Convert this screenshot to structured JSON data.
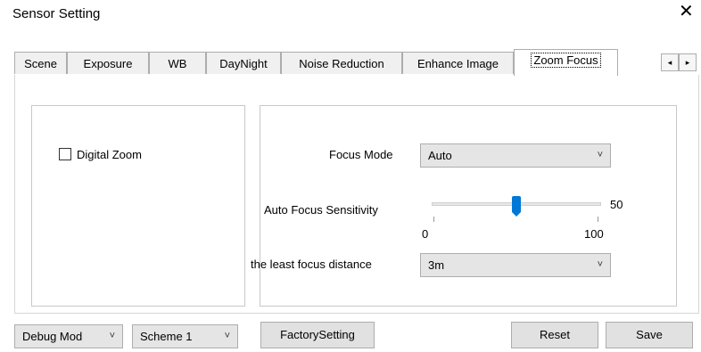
{
  "window": {
    "title": "Sensor Setting",
    "close_glyph": "✕"
  },
  "tabs": [
    {
      "label": "Scene"
    },
    {
      "label": "Exposure"
    },
    {
      "label": "WB"
    },
    {
      "label": "DayNight"
    },
    {
      "label": "Noise Reduction"
    },
    {
      "label": "Enhance Image"
    },
    {
      "label": "Zoom Focus"
    }
  ],
  "active_tab": "Zoom Focus",
  "tab_scroll": {
    "left_glyph": "◂",
    "right_glyph": "▸"
  },
  "digital_zoom": {
    "label": "Digital Zoom",
    "checked": false
  },
  "focus_mode": {
    "label": "Focus Mode",
    "value": "Auto"
  },
  "af_sensitivity": {
    "label": "Auto Focus Sensitivity",
    "value": "50",
    "min": "0",
    "max": "100"
  },
  "least_focus_distance": {
    "label": "the least focus distance",
    "value": "3m"
  },
  "bottom": {
    "debug_mode": "Debug Mod",
    "scheme": "Scheme 1",
    "factory_setting": "FactorySetting",
    "reset": "Reset",
    "save": "Save"
  },
  "icons": {
    "chevron": "chevron-down-icon",
    "close": "close-icon"
  },
  "colors": {
    "accent": "#0078d7"
  }
}
